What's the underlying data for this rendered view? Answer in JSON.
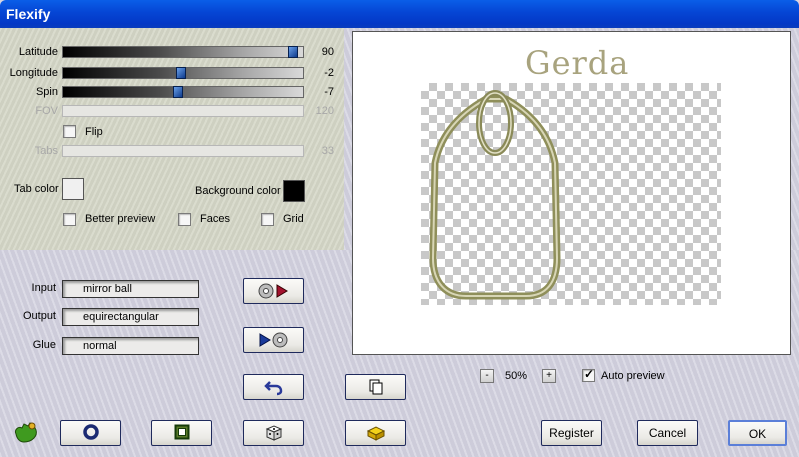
{
  "window": {
    "title": "Flexify"
  },
  "sliders": [
    {
      "label": "Latitude",
      "value": "90",
      "level": 0.98,
      "enabled": true
    },
    {
      "label": "Longitude",
      "value": "-2",
      "level": 0.49,
      "enabled": true
    },
    {
      "label": "Spin",
      "value": "-7",
      "level": 0.48,
      "enabled": true
    },
    {
      "label": "FOV",
      "value": "120",
      "level": null,
      "enabled": false
    }
  ],
  "flip": {
    "label": "Flip",
    "checked": false
  },
  "tabs": {
    "label": "Tabs",
    "value": "33",
    "enabled": false
  },
  "tab_color": {
    "label": "Tab color",
    "color": "#f0f0f0"
  },
  "background_color": {
    "label": "Background color",
    "color": "#000000"
  },
  "options": [
    {
      "label": "Better preview",
      "checked": false
    },
    {
      "label": "Faces",
      "checked": false
    },
    {
      "label": "Grid",
      "checked": false
    }
  ],
  "io": {
    "input_label": "Input",
    "input_value": "mirror ball",
    "output_label": "Output",
    "output_value": "equirectangular",
    "glue_label": "Glue",
    "glue_value": "normal"
  },
  "preview": {
    "watermark": "Gerda"
  },
  "zoom": {
    "minus": "-",
    "value": "50%",
    "plus": "+"
  },
  "auto_preview": {
    "label": "Auto preview",
    "checked": true
  },
  "buttons": {
    "register": "Register",
    "cancel": "Cancel",
    "ok": "OK"
  },
  "icons": {
    "convert_forward": "disc-to-arrow-icon",
    "convert_back": "arrow-to-disc-icon",
    "undo": "undo-arrow-icon",
    "copy": "copy-pages-icon",
    "logo": "hand-logo-icon",
    "ring": "ring-icon",
    "square": "square-frame-icon",
    "dice": "dice-icon",
    "brick": "brick-icon"
  },
  "colors": {
    "titlebar": "#0545d4",
    "accent": "#0d3a8c"
  }
}
